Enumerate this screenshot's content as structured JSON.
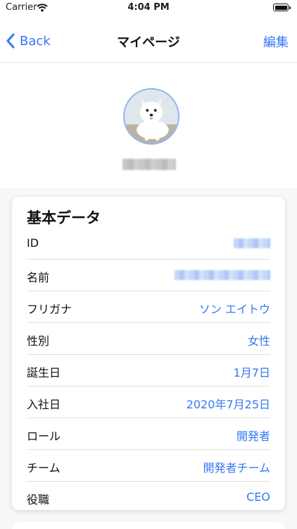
{
  "status_bar": {
    "carrier": "Carrier",
    "time": "4:04 PM"
  },
  "nav": {
    "back_label": "Back",
    "title": "マイページ",
    "edit_label": "編集"
  },
  "profile": {
    "avatar_icon": "dog-photo-avatar"
  },
  "card": {
    "title": "基本データ",
    "rows": [
      {
        "label": "ID",
        "value": ""
      },
      {
        "label": "名前",
        "value": ""
      },
      {
        "label": "フリガナ",
        "value": "ソン エイトウ"
      },
      {
        "label": "性別",
        "value": "女性"
      },
      {
        "label": "誕生日",
        "value": "1月7日"
      },
      {
        "label": "入社日",
        "value": "2020年7月25日"
      },
      {
        "label": "ロール",
        "value": "開発者"
      },
      {
        "label": "チーム",
        "value": "開発者チーム"
      },
      {
        "label": "役職",
        "value": "CEO"
      }
    ]
  },
  "colors": {
    "accent": "#3478f6",
    "avatar_ring": "#8fb2f0"
  }
}
